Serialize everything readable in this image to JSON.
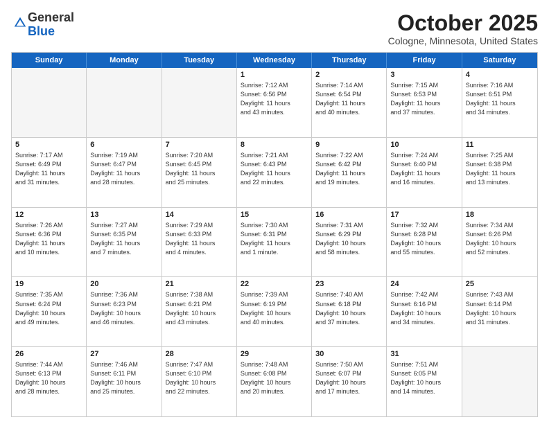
{
  "logo": {
    "general": "General",
    "blue": "Blue"
  },
  "title": "October 2025",
  "subtitle": "Cologne, Minnesota, United States",
  "header_days": [
    "Sunday",
    "Monday",
    "Tuesday",
    "Wednesday",
    "Thursday",
    "Friday",
    "Saturday"
  ],
  "rows": [
    [
      {
        "day": "",
        "info": ""
      },
      {
        "day": "",
        "info": ""
      },
      {
        "day": "",
        "info": ""
      },
      {
        "day": "1",
        "info": "Sunrise: 7:12 AM\nSunset: 6:56 PM\nDaylight: 11 hours\nand 43 minutes."
      },
      {
        "day": "2",
        "info": "Sunrise: 7:14 AM\nSunset: 6:54 PM\nDaylight: 11 hours\nand 40 minutes."
      },
      {
        "day": "3",
        "info": "Sunrise: 7:15 AM\nSunset: 6:53 PM\nDaylight: 11 hours\nand 37 minutes."
      },
      {
        "day": "4",
        "info": "Sunrise: 7:16 AM\nSunset: 6:51 PM\nDaylight: 11 hours\nand 34 minutes."
      }
    ],
    [
      {
        "day": "5",
        "info": "Sunrise: 7:17 AM\nSunset: 6:49 PM\nDaylight: 11 hours\nand 31 minutes."
      },
      {
        "day": "6",
        "info": "Sunrise: 7:19 AM\nSunset: 6:47 PM\nDaylight: 11 hours\nand 28 minutes."
      },
      {
        "day": "7",
        "info": "Sunrise: 7:20 AM\nSunset: 6:45 PM\nDaylight: 11 hours\nand 25 minutes."
      },
      {
        "day": "8",
        "info": "Sunrise: 7:21 AM\nSunset: 6:43 PM\nDaylight: 11 hours\nand 22 minutes."
      },
      {
        "day": "9",
        "info": "Sunrise: 7:22 AM\nSunset: 6:42 PM\nDaylight: 11 hours\nand 19 minutes."
      },
      {
        "day": "10",
        "info": "Sunrise: 7:24 AM\nSunset: 6:40 PM\nDaylight: 11 hours\nand 16 minutes."
      },
      {
        "day": "11",
        "info": "Sunrise: 7:25 AM\nSunset: 6:38 PM\nDaylight: 11 hours\nand 13 minutes."
      }
    ],
    [
      {
        "day": "12",
        "info": "Sunrise: 7:26 AM\nSunset: 6:36 PM\nDaylight: 11 hours\nand 10 minutes."
      },
      {
        "day": "13",
        "info": "Sunrise: 7:27 AM\nSunset: 6:35 PM\nDaylight: 11 hours\nand 7 minutes."
      },
      {
        "day": "14",
        "info": "Sunrise: 7:29 AM\nSunset: 6:33 PM\nDaylight: 11 hours\nand 4 minutes."
      },
      {
        "day": "15",
        "info": "Sunrise: 7:30 AM\nSunset: 6:31 PM\nDaylight: 11 hours\nand 1 minute."
      },
      {
        "day": "16",
        "info": "Sunrise: 7:31 AM\nSunset: 6:29 PM\nDaylight: 10 hours\nand 58 minutes."
      },
      {
        "day": "17",
        "info": "Sunrise: 7:32 AM\nSunset: 6:28 PM\nDaylight: 10 hours\nand 55 minutes."
      },
      {
        "day": "18",
        "info": "Sunrise: 7:34 AM\nSunset: 6:26 PM\nDaylight: 10 hours\nand 52 minutes."
      }
    ],
    [
      {
        "day": "19",
        "info": "Sunrise: 7:35 AM\nSunset: 6:24 PM\nDaylight: 10 hours\nand 49 minutes."
      },
      {
        "day": "20",
        "info": "Sunrise: 7:36 AM\nSunset: 6:23 PM\nDaylight: 10 hours\nand 46 minutes."
      },
      {
        "day": "21",
        "info": "Sunrise: 7:38 AM\nSunset: 6:21 PM\nDaylight: 10 hours\nand 43 minutes."
      },
      {
        "day": "22",
        "info": "Sunrise: 7:39 AM\nSunset: 6:19 PM\nDaylight: 10 hours\nand 40 minutes."
      },
      {
        "day": "23",
        "info": "Sunrise: 7:40 AM\nSunset: 6:18 PM\nDaylight: 10 hours\nand 37 minutes."
      },
      {
        "day": "24",
        "info": "Sunrise: 7:42 AM\nSunset: 6:16 PM\nDaylight: 10 hours\nand 34 minutes."
      },
      {
        "day": "25",
        "info": "Sunrise: 7:43 AM\nSunset: 6:14 PM\nDaylight: 10 hours\nand 31 minutes."
      }
    ],
    [
      {
        "day": "26",
        "info": "Sunrise: 7:44 AM\nSunset: 6:13 PM\nDaylight: 10 hours\nand 28 minutes."
      },
      {
        "day": "27",
        "info": "Sunrise: 7:46 AM\nSunset: 6:11 PM\nDaylight: 10 hours\nand 25 minutes."
      },
      {
        "day": "28",
        "info": "Sunrise: 7:47 AM\nSunset: 6:10 PM\nDaylight: 10 hours\nand 22 minutes."
      },
      {
        "day": "29",
        "info": "Sunrise: 7:48 AM\nSunset: 6:08 PM\nDaylight: 10 hours\nand 20 minutes."
      },
      {
        "day": "30",
        "info": "Sunrise: 7:50 AM\nSunset: 6:07 PM\nDaylight: 10 hours\nand 17 minutes."
      },
      {
        "day": "31",
        "info": "Sunrise: 7:51 AM\nSunset: 6:05 PM\nDaylight: 10 hours\nand 14 minutes."
      },
      {
        "day": "",
        "info": ""
      }
    ]
  ]
}
